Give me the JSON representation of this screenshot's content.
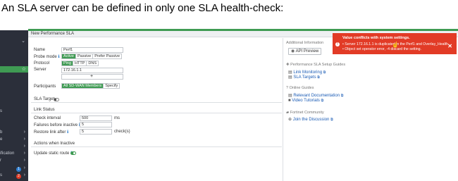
{
  "caption": "An SLA server can be defined in only one SLA health-check:",
  "pane": {
    "title": "New Performance SLA"
  },
  "sidebar": {
    "rows": [
      {
        "text": "",
        "chevron": ""
      },
      {
        "text": "",
        "chevron": "⌄"
      },
      {
        "text": "",
        "chevron": ""
      },
      {
        "text": "",
        "chevron": ""
      },
      {
        "text": "",
        "chevron": ""
      },
      {
        "text": "",
        "chevron": ""
      },
      {
        "text": "",
        "chevron": ""
      },
      {
        "text": "",
        "chevron": ""
      },
      {
        "text": "",
        "chevron": ""
      },
      {
        "text": "",
        "chevron": ""
      },
      {
        "text": "s",
        "chevron": ""
      },
      {
        "text": "",
        "chevron": ""
      },
      {
        "text": "",
        "chevron": ""
      },
      {
        "text": "",
        "chevron": ""
      },
      {
        "text": "",
        "chevron": ""
      },
      {
        "text": "",
        "chevron": ""
      },
      {
        "text": "b",
        "chevron": "›"
      },
      {
        "text": "e",
        "chevron": "›"
      },
      {
        "text": "",
        "chevron": "›"
      },
      {
        "text": "ification",
        "chevron": "›"
      },
      {
        "text": "r",
        "chevron": "›"
      },
      {
        "text": "",
        "chevron": "›"
      },
      {
        "text": "s",
        "chevron": "›"
      }
    ],
    "badge_blue": "1",
    "badge_red": "2"
  },
  "form": {
    "name_label": "Name",
    "name_value": "Perf1",
    "probe_label": "Probe mode",
    "probe_options": [
      "Active",
      "Passive",
      "Prefer Passive"
    ],
    "protocol_label": "Protocol",
    "protocol_options": [
      "Ping",
      "HTTP",
      "DNS"
    ],
    "server_label": "Server",
    "server_value": "172.16.1.1",
    "participants_label": "Participants",
    "participants_options": [
      "All SD-WAN Members",
      "Specify"
    ],
    "sla_target_label": "SLA Target",
    "link_status_label": "Link Status",
    "check_interval_label": "Check interval",
    "check_interval_value": "500",
    "check_interval_unit": "ms",
    "failures_label": "Failures before inactive",
    "failures_value": "5",
    "restore_label": "Restore link after",
    "restore_value": "5",
    "restore_unit": "check(s)",
    "actions_label": "Actions when Inactive",
    "update_route_label": "Update static route"
  },
  "side": {
    "additional_info": "Additional Information",
    "api_preview": "API Preview",
    "setup_guides": "Performance SLA Setup Guides",
    "link_monitoring": "Link Monitoring",
    "sla_targets": "SLA Targets",
    "online_guides": "Online Guides",
    "relevant_doc": "Relevant Documentation",
    "video_tutorials": "Video Tutorials",
    "community": "Fortinet Community",
    "join_discussion": "Join the Discussion"
  },
  "toast": {
    "title": "Value conflicts with system settings.",
    "line1": "• Server 172.16.1.1 is duplicated in the Perf1 and Overlay_Health.",
    "line2": "• Object set operator error, -4 discard the setting.",
    "close": "✕",
    "color": "#e23b26"
  },
  "colors": {
    "accent": "#3f9b53",
    "sidebar": "#2b2f3a",
    "link": "#1a5bb5"
  }
}
